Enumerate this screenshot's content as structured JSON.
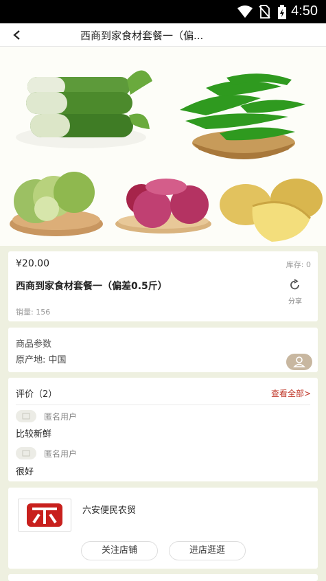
{
  "status_bar": {
    "time": "4:50"
  },
  "header": {
    "title": "西商到家食材套餐一（偏..."
  },
  "product": {
    "price": "¥20.00",
    "stock": "库存: 0",
    "title": "西商到家食材套餐一（偏差0.5斤）",
    "share_label": "分享",
    "sales": "销量: 156"
  },
  "params": {
    "section_title": "商品参数",
    "origin": "原产地: 中国"
  },
  "reviews": {
    "title": "评价（2）",
    "see_all": "查看全部>",
    "items": [
      {
        "user": "匿名用户",
        "text": "比较新鲜"
      },
      {
        "user": "匿名用户",
        "text": "很好"
      }
    ]
  },
  "shop": {
    "name": "六安便民农贸",
    "follow_label": "关注店铺",
    "enter_label": "进店逛逛"
  },
  "colors": {
    "accent": "#c0392b",
    "background": "#eef0e0",
    "logo_red": "#c8201d"
  }
}
